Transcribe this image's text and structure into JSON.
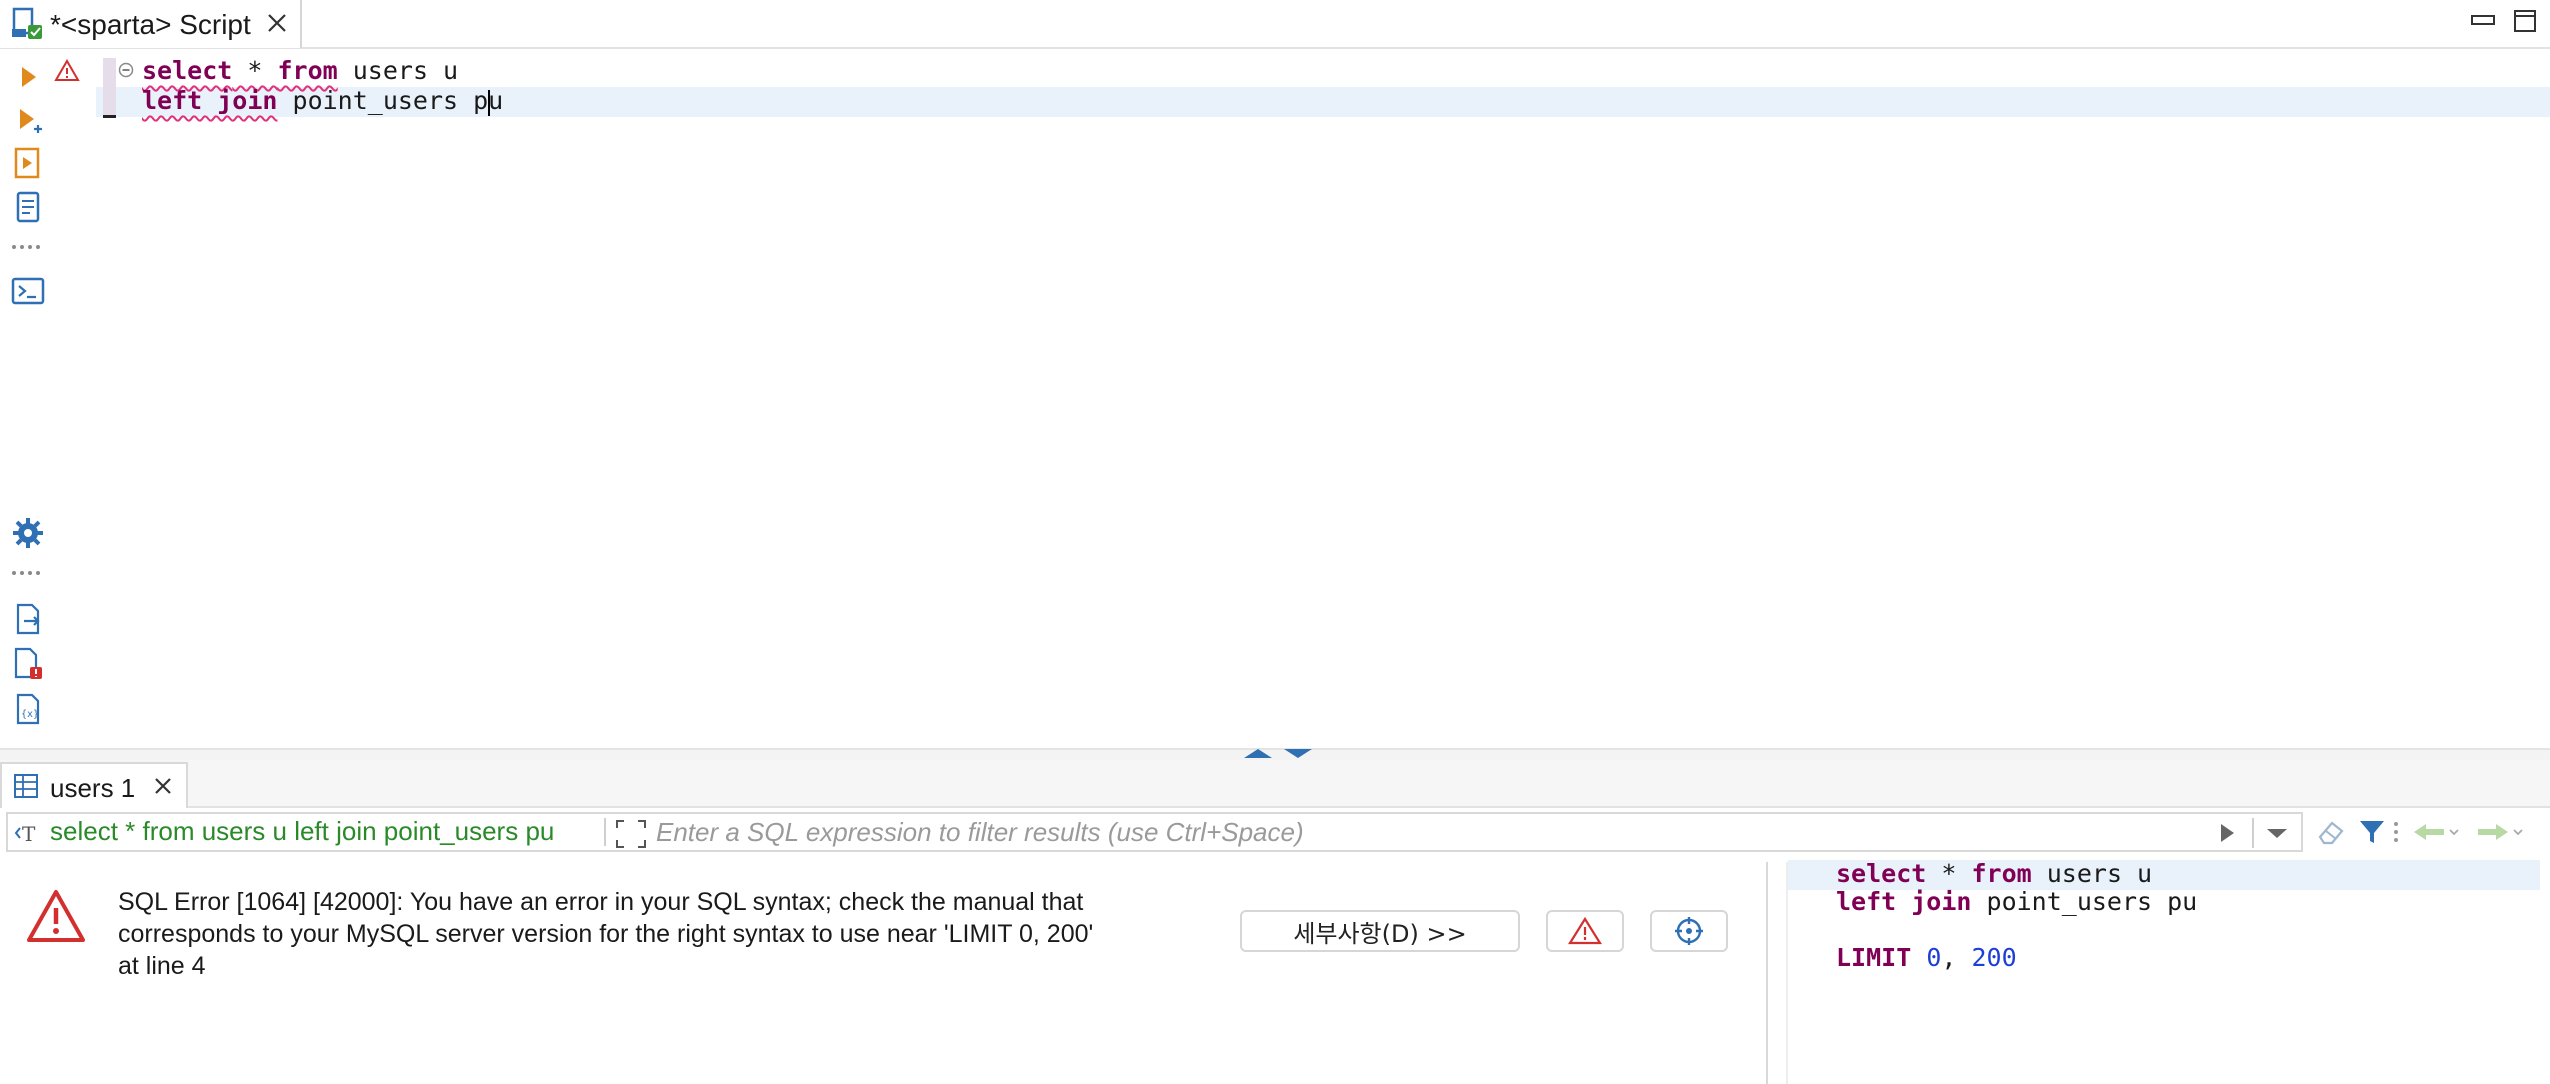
{
  "editor_tab": {
    "title": "*<sparta> Script"
  },
  "editor": {
    "lines": [
      {
        "kw1": "select",
        "rest1": " * ",
        "kw2": "from",
        "rest2": " users u"
      },
      {
        "kw1": "left join",
        "rest1": " point_users pu"
      }
    ]
  },
  "results": {
    "tab_label": "users 1",
    "query_summary": "select * from users u left join point_users pu",
    "filter_placeholder": "Enter a SQL expression to filter results (use Ctrl+Space)",
    "error_message": "SQL Error [1064] [42000]: You have an error in your SQL syntax; check the manual that\ncorresponds to your MySQL server version for the right syntax to use near 'LIMIT 0, 200'\nat line 4",
    "details_button": "세부사항(D) >>"
  },
  "query_panel": {
    "line1_kw1": "select",
    "line1_mid": " * ",
    "line1_kw2": "from",
    "line1_rest": " users u",
    "line2_kw": "left join",
    "line2_rest": " point_users pu",
    "line4_kw": "LIMIT",
    "line4_n1": "0",
    "line4_sep": ", ",
    "line4_n2": "200"
  },
  "colors": {
    "keyword": "#7f0055",
    "number": "#1d3fd6",
    "query_green": "#2a8a2a",
    "error_red": "#d32f2f",
    "icon_blue": "#2f6fb3",
    "icon_orange": "#e08a1e"
  },
  "icons": {
    "tab": "sql-script-icon",
    "toolbar": [
      "execute-statement-icon",
      "execute-in-new-tab-icon",
      "execute-script-icon",
      "explain-plan-icon",
      "more-dots-icon",
      "console-icon",
      "settings-gear-icon",
      "more-dots-icon",
      "export-icon",
      "problems-icon",
      "variables-icon"
    ]
  }
}
